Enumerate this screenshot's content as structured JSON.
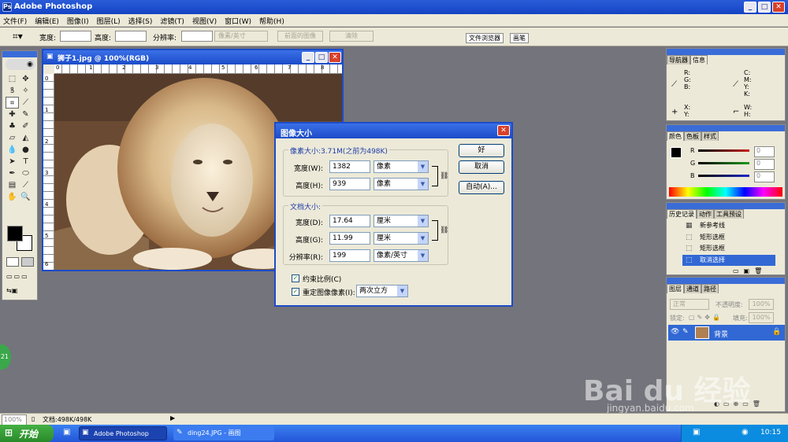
{
  "app": {
    "title": "Adobe Photoshop",
    "icon": "photoshop-icon"
  },
  "menu": [
    "文件(F)",
    "编辑(E)",
    "图像(I)",
    "图层(L)",
    "选择(S)",
    "滤镜(T)",
    "视图(V)",
    "窗口(W)",
    "帮助(H)"
  ],
  "options": {
    "width_label": "宽度:",
    "height_label": "高度:",
    "resolution_label": "分辨率:",
    "unit_value": "像素/英寸",
    "front_image_btn": "前面的图像",
    "clear_btn": "清除",
    "tab_file_browser": "文件浏览器",
    "tab_brushes": "画笔"
  },
  "document": {
    "title": "狮子1.jpg @ 100%(RGB)",
    "ruler_h": [
      "0",
      "1",
      "2",
      "3",
      "4",
      "5",
      "6",
      "7",
      "8"
    ],
    "ruler_v": [
      "0",
      "1",
      "2",
      "3",
      "4",
      "5",
      "6"
    ]
  },
  "dialog": {
    "title": "图像大小",
    "pixel_group": "像素大小:3.71M(之前为498K)",
    "width_label": "宽度(W):",
    "width_value": "1382",
    "width_unit": "像素",
    "height_label": "高度(H):",
    "height_value": "939",
    "height_unit": "像素",
    "doc_group": "文档大小:",
    "doc_width_label": "宽度(D):",
    "doc_width_value": "17.64",
    "doc_width_unit": "厘米",
    "doc_height_label": "高度(G):",
    "doc_height_value": "11.99",
    "doc_height_unit": "厘米",
    "res_label": "分辨率(R):",
    "res_value": "199",
    "res_unit": "像素/英寸",
    "constrain_label": "约束比例(C)",
    "resample_label": "重定图像像素(I):",
    "resample_value": "两次立方",
    "ok": "好",
    "cancel": "取消",
    "auto": "自动(A)..."
  },
  "navigator": {
    "tabs": [
      "导航器",
      "信息"
    ],
    "rgb": [
      "R:",
      "G:",
      "B:"
    ],
    "cmyk": [
      "C:",
      "M:",
      "Y:",
      "K:"
    ],
    "xy": [
      "X:",
      "Y:"
    ],
    "wh": [
      "W:",
      "H:"
    ]
  },
  "color": {
    "tabs": [
      "颜色",
      "色板",
      "样式"
    ],
    "channels": [
      {
        "label": "R",
        "value": "0",
        "color": "#c8201c"
      },
      {
        "label": "G",
        "value": "0",
        "color": "#1c9a1c"
      },
      {
        "label": "B",
        "value": "0",
        "color": "#1c2ac8"
      }
    ]
  },
  "history": {
    "tabs": [
      "历史记录",
      "动作",
      "工具预设"
    ],
    "items": [
      "新参考线",
      "矩形选框",
      "矩形选框",
      "取消选择"
    ]
  },
  "layers": {
    "tabs": [
      "图层",
      "通道",
      "路径"
    ],
    "mode": "正常",
    "opacity_label": "不透明度:",
    "opacity": "100%",
    "lock_label": "锁定:",
    "fill_label": "填充:",
    "fill": "100%",
    "layer_name": "背景"
  },
  "status": {
    "zoom": "100%",
    "doc": "文档:498K/498K"
  },
  "taskbar": {
    "start": "开始",
    "tasks": [
      "Adobe Photoshop",
      "ding24.JPG - 画图"
    ],
    "clock": "10:15"
  },
  "side_badge": "21",
  "watermark": {
    "brand": "Bai du 经验",
    "url": "jingyan.baidu.com"
  }
}
